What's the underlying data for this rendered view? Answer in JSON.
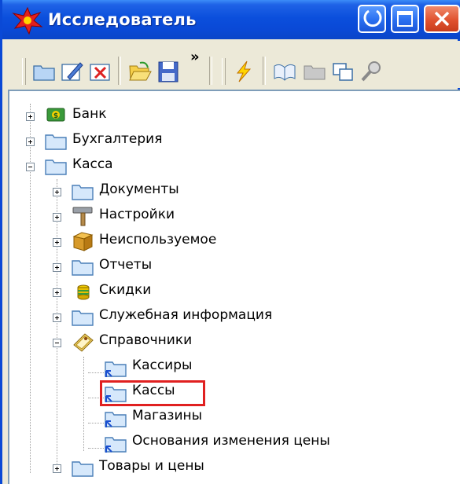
{
  "window": {
    "title": "Исследователь",
    "title_icon": "explorer-star-icon",
    "buttons": [
      "minimize",
      "maximize",
      "close"
    ]
  },
  "toolbar": {
    "icons": [
      "new-folder-icon",
      "edit-icon",
      "delete-icon",
      "open-folder-icon",
      "save-icon",
      "more-chevron",
      "lightning-icon",
      "open-book-icon",
      "folder-icon",
      "copy-windows-icon",
      "search-icon"
    ],
    "more": "»"
  },
  "tree": {
    "nodes": [
      {
        "label": "Банк",
        "icon": "bank-icon",
        "expander": "plus"
      },
      {
        "label": "Бухгалтерия",
        "icon": "folder-icon",
        "expander": "plus"
      },
      {
        "label": "Касса",
        "icon": "folder-icon",
        "expander": "minus"
      },
      {
        "label": "Документы",
        "icon": "folder-icon",
        "expander": "plus"
      },
      {
        "label": "Настройки",
        "icon": "hammer-icon",
        "expander": "plus"
      },
      {
        "label": "Неиспользуемое",
        "icon": "box-icon",
        "expander": "plus"
      },
      {
        "label": "Отчеты",
        "icon": "folder-icon",
        "expander": "plus"
      },
      {
        "label": "Скидки",
        "icon": "coins-icon",
        "expander": "plus"
      },
      {
        "label": "Служебная информация",
        "icon": "folder-icon",
        "expander": "plus"
      },
      {
        "label": "Справочники",
        "icon": "reference-book-icon",
        "expander": "minus"
      },
      {
        "label": "Кассиры",
        "icon": "shortcut-folder-icon",
        "expander": "none"
      },
      {
        "label": "Кассы",
        "icon": "shortcut-folder-icon",
        "expander": "none",
        "highlighted": true
      },
      {
        "label": "Магазины",
        "icon": "shortcut-folder-icon",
        "expander": "none"
      },
      {
        "label": "Основания изменения цены",
        "icon": "shortcut-folder-icon",
        "expander": "none"
      },
      {
        "label": "Товары и цены",
        "icon": "folder-icon",
        "expander": "plus"
      }
    ]
  },
  "colors": {
    "titlebar": "#0a49d6",
    "highlight": "#e02020",
    "folder": "#7fb6f0"
  }
}
